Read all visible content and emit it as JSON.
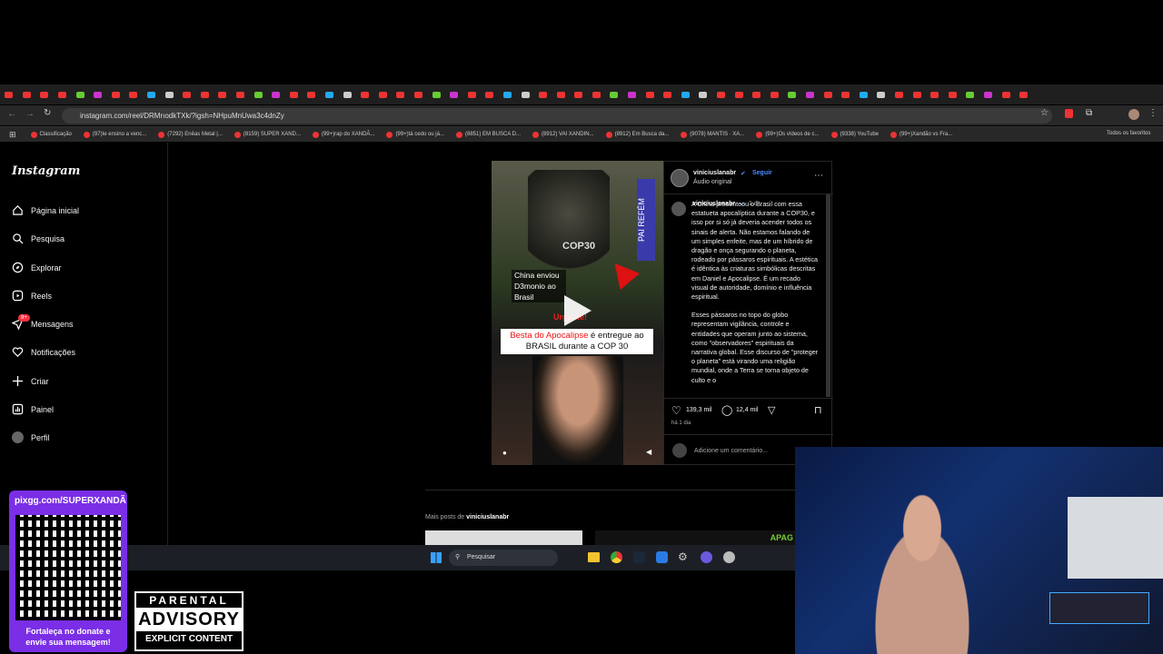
{
  "browser": {
    "url": "instagram.com/reel/DRMrıodkTXk/?igsh=NHpuMnUwa3c4dnZy",
    "bookmarks": [
      "Classificação",
      "(97)Ie ensino a venc...",
      "(7292) Eněas Metal |...",
      "(8159) SUPER XAND...",
      "(99+)rap do XANDÃ...",
      "(99+)tá cedo ou já...",
      "(8851) EM BUSCA D...",
      "(8912) VAI XANDIN...",
      "(8912) Em Busca da...",
      "(9078) MANTIS · XA...",
      "(99+)Os vídeos de c...",
      "(9338) YouTube",
      "(99+)Xandão vs Fra..."
    ],
    "all_bookmarks": "Todos os favoritos"
  },
  "sidebar": {
    "logo": "Instagram",
    "items": [
      "Página inicial",
      "Pesquisa",
      "Explorar",
      "Reels",
      "Mensagens",
      "Notificações",
      "Criar",
      "Painel",
      "Perfil"
    ],
    "messages_badge": "9+"
  },
  "video": {
    "cop": "COP30",
    "overlay": "China enviou D3monio ao Brasil",
    "alert": "Urgente!",
    "headline_red": "Besta do Apocalipse",
    "headline_rest": " é entregue ao BRASIL durante a COP 30",
    "banner": "PAI REFÉM"
  },
  "post": {
    "user": "viniciuslanabr",
    "follow": "Seguir",
    "audio": "Áudio original",
    "age": "1 d",
    "caption1": "A China presenteou o Brasil com essa estatueta apocalíptica durante a COP30, e isso por si só já deveria acender todos os sinais de alerta. Não estamos falando de um simples enfeite, mas de um híbrido de dragão e onça segurando o planeta, rodeado por pássaros espirituais. A estética é idêntica às criaturas simbólicas descritas em Daniel e Apocalipse. É um recado visual de autoridade, domínio e influência espiritual.",
    "caption2": "Esses pássaros no topo do globo representam vigilância, controle e entidades que operam junto ao sistema, como \"observadores\" espirituais da narrativa global. Esse discurso de \"proteger o planeta\" está virando uma religião mundial, onde a Terra se torna objeto de culto e o",
    "likes": "139,3 mil",
    "comments": "12,4 mil",
    "time": "há 1 dia",
    "comment_placeholder": "Adicione um comentário..."
  },
  "more": {
    "label": "Mais posts de ",
    "user": "viniciuslanabr",
    "thumb": "APAG"
  },
  "taskbar": {
    "search": "Pesquisar"
  },
  "overlay": {
    "pix": "pixgg.com/SUPERXANDÃ",
    "donate": "Fortaleça no donate e envie sua mensagem!",
    "pa1": "PARENTAL",
    "pa2": "ADVISORY",
    "pa3": "EXPLICIT CONTENT"
  }
}
